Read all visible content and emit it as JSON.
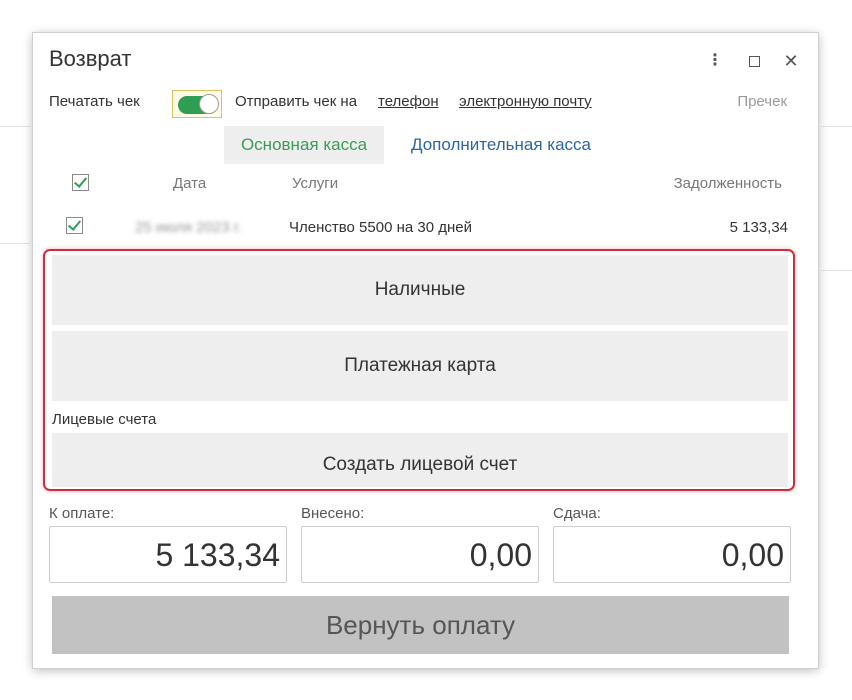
{
  "dialog": {
    "title": "Возврат",
    "window_controls": {
      "more_icon": "more-vertical-icon",
      "maximize_icon": "maximize-icon",
      "close_icon": "close-icon"
    }
  },
  "receipt_options": {
    "print_label": "Печатать чек",
    "print_toggle_on": true,
    "send_label": "Отправить чек на",
    "phone_link": "телефон",
    "email_link": "электронную почту",
    "reprint_label": "Пречек"
  },
  "tabs": [
    {
      "label": "Основная касса",
      "active": true
    },
    {
      "label": "Дополнительная касса",
      "active": false
    }
  ],
  "table": {
    "columns": [
      "Дата",
      "Услуги",
      "Задолженность"
    ],
    "rows": [
      {
        "checked": true,
        "date": "25 июля 2023 г.",
        "service": "Членство 5500 на 30 дней",
        "debt": "5 133,34"
      }
    ]
  },
  "payment": {
    "cash": "Наличные",
    "card": "Платежная карта",
    "accounts_label": "Лицевые счета",
    "create_account": "Создать лицевой счет"
  },
  "totals": {
    "to_pay_label": "К оплате:",
    "to_pay_value": "5 133,34",
    "paid_label": "Внесено:",
    "paid_value": "0,00",
    "change_label": "Сдача:",
    "change_value": "0,00"
  },
  "actions": {
    "refund_label": "Вернуть оплату"
  },
  "colors": {
    "accent_green": "#2e9e52",
    "link_blue": "#2a65a8",
    "highlight_red": "#d42a3a"
  }
}
